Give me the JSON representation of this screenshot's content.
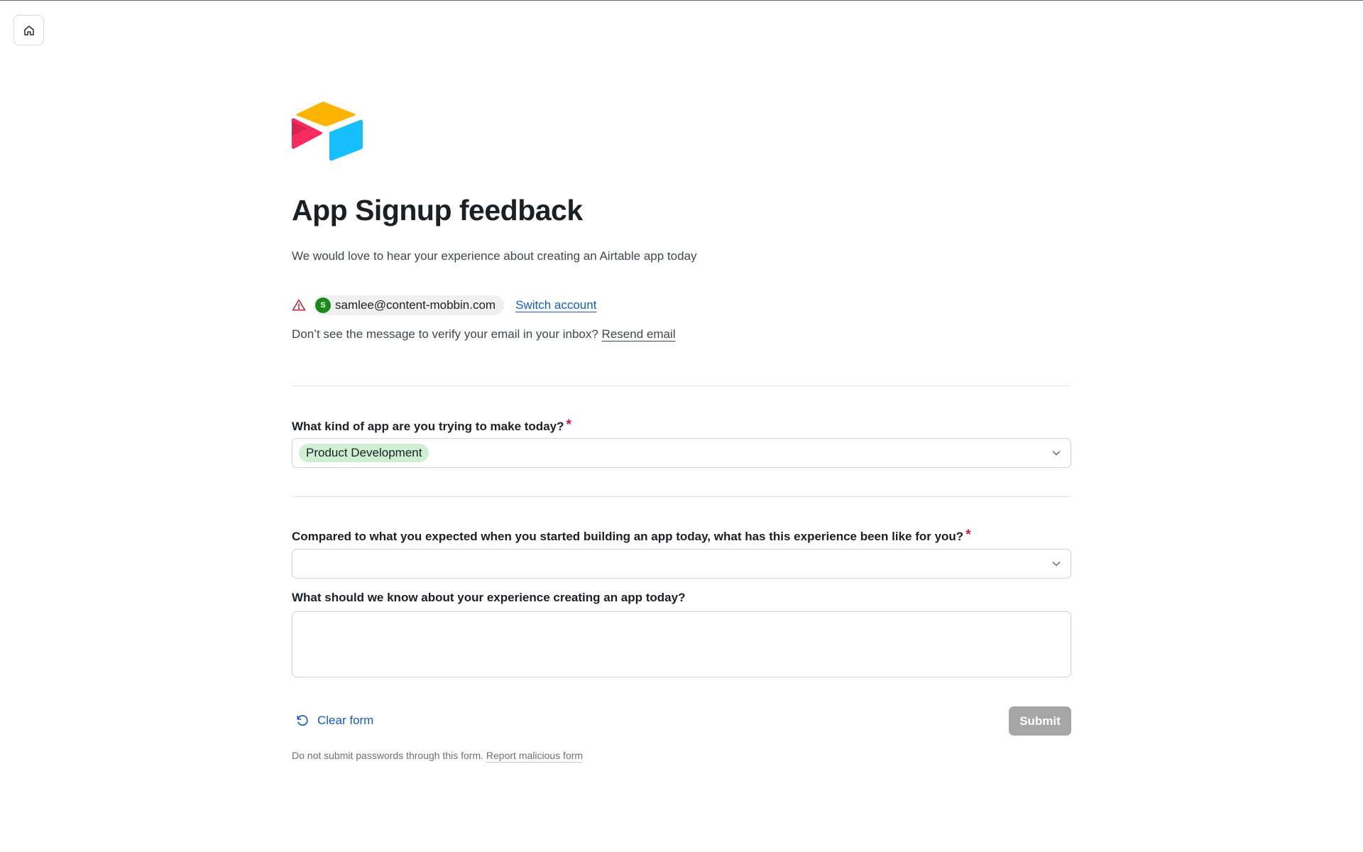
{
  "form": {
    "title": "App Signup feedback",
    "subtitle": "We would love to hear your experience about creating an Airtable app today"
  },
  "account": {
    "avatar_initial": "S",
    "email": "samlee@content-mobbin.com",
    "switch_label": "Switch account",
    "verify_text": "Don’t see the message to verify your email in your inbox? ",
    "resend_label": "Resend email"
  },
  "questions": [
    {
      "label": "What kind of app are you trying to make today?",
      "required_mark": "*",
      "selected_value": "Product Development"
    },
    {
      "label": "Compared to what you expected when you started building an app today, what has this experience been like for you?",
      "required_mark": "*",
      "selected_value": ""
    },
    {
      "label": "What should we know about your experience creating an app today?",
      "value": ""
    }
  ],
  "actions": {
    "clear_label": "Clear form",
    "submit_label": "Submit"
  },
  "footer": {
    "note": "Do not submit passwords through this form. ",
    "report_label": "Report malicious form"
  },
  "colors": {
    "link": "#1659c7",
    "required": "#d6153f",
    "pill_bg": "#cfefd2",
    "submit_disabled": "#a6a6a6",
    "avatar_bg": "#1a8a1a"
  },
  "icons": {
    "home": "home-icon",
    "warning": "warning-triangle-icon",
    "chevron": "chevron-down-icon",
    "clear": "undo-icon",
    "logo": "airtable-logo"
  }
}
